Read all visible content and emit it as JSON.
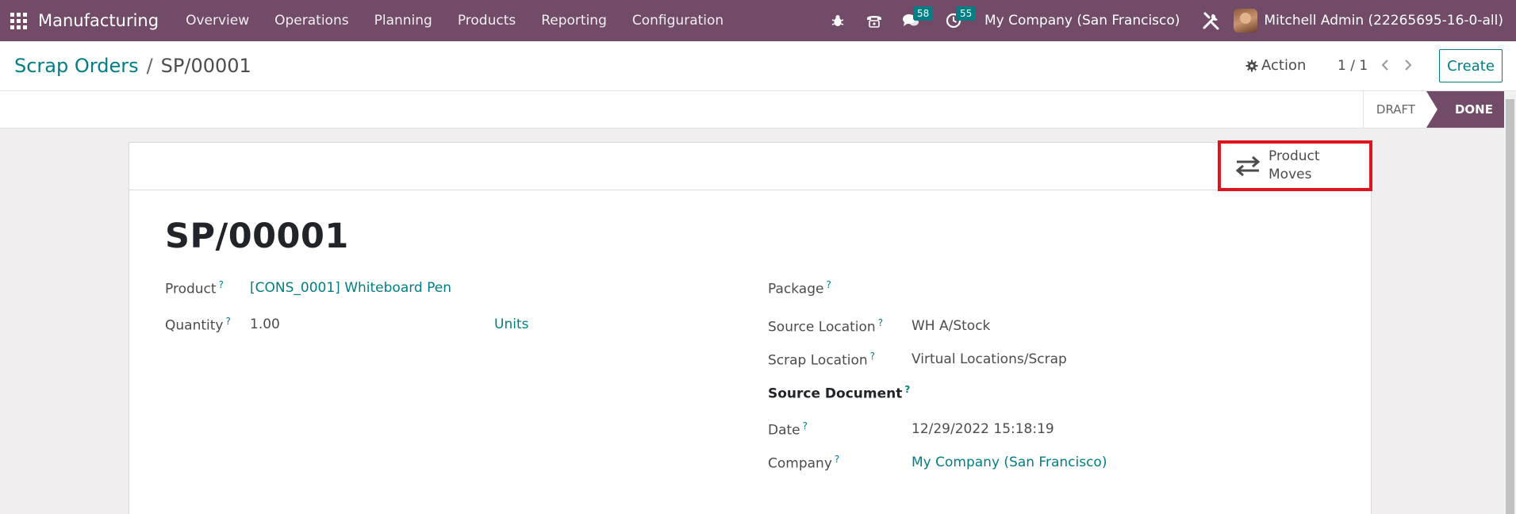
{
  "navbar": {
    "app_name": "Manufacturing",
    "menu": [
      "Overview",
      "Operations",
      "Planning",
      "Products",
      "Reporting",
      "Configuration"
    ],
    "messages_count": "58",
    "activities_count": "55",
    "company": "My Company (San Francisco)",
    "user": "Mitchell Admin (22265695-16-0-all)"
  },
  "breadcrumb": {
    "parent": "Scrap Orders",
    "separator": "/",
    "current": "SP/00001"
  },
  "control": {
    "action_label": "Action",
    "pager": "1 / 1",
    "create_label": "Create"
  },
  "status": {
    "draft": "DRAFT",
    "done": "DONE"
  },
  "smart_button": {
    "line1": "Product",
    "line2": "Moves"
  },
  "record": {
    "title": "SP/00001",
    "help_mark": "?",
    "left": {
      "product_label": "Product",
      "product_value": "[CONS_0001] Whiteboard Pen",
      "quantity_label": "Quantity",
      "quantity_value": "1.00",
      "uom_value": "Units"
    },
    "right": {
      "package_label": "Package",
      "source_location_label": "Source Location",
      "source_location_value": "WH A/Stock",
      "scrap_location_label": "Scrap Location",
      "scrap_location_value": "Virtual Locations/Scrap",
      "source_document_label": "Source Document",
      "date_label": "Date",
      "date_value": "12/29/2022 15:18:19",
      "company_label": "Company",
      "company_value": "My Company (San Francisco)"
    }
  },
  "colors": {
    "brand": "#714b67",
    "accent": "#017e84",
    "highlight": "#e0141e"
  }
}
